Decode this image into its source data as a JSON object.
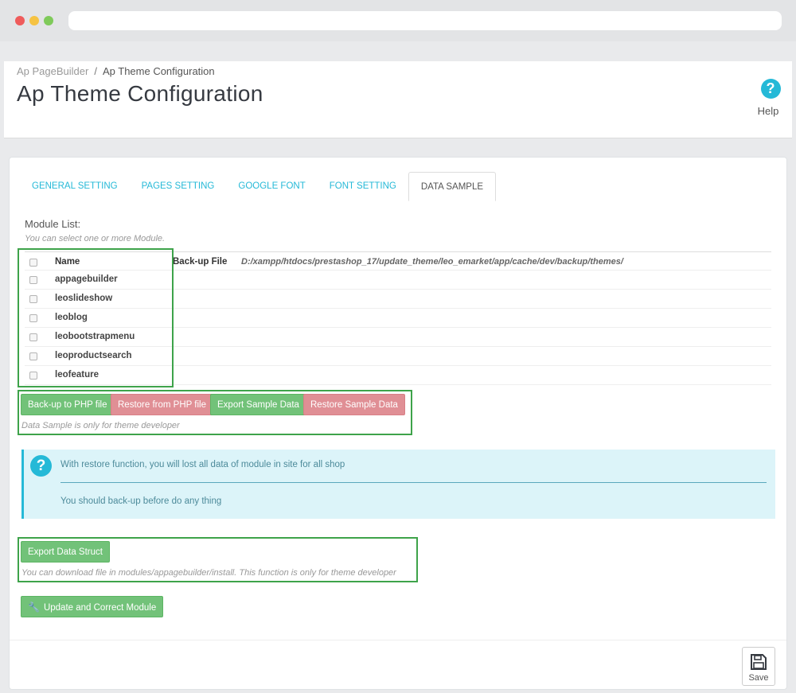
{
  "header": {
    "breadcrumb": [
      "Ap PageBuilder",
      "Ap Theme Configuration"
    ],
    "breadcrumb_sep": "/",
    "title": "Ap Theme Configuration",
    "help_icon_glyph": "?",
    "help_label": "Help"
  },
  "tabs": [
    {
      "label": "GENERAL SETTING",
      "active": false
    },
    {
      "label": "PAGES SETTING",
      "active": false
    },
    {
      "label": "GOOGLE FONT",
      "active": false
    },
    {
      "label": "FONT SETTING",
      "active": false
    },
    {
      "label": "DATA SAMPLE",
      "active": true
    }
  ],
  "module_list": {
    "label": "Module List:",
    "help": "You can select one or more Module.",
    "name_header": "Name",
    "backup_label": "Back-up File",
    "backup_path": "D:/xampp/htdocs/prestashop_17/update_theme/leo_emarket/app/cache/dev/backup/themes/",
    "modules": [
      "appagebuilder",
      "leoslideshow",
      "leoblog",
      "leobootstrapmenu",
      "leoproductsearch",
      "leofeature"
    ]
  },
  "actions": {
    "backup_php": "Back-up to PHP file",
    "restore_php": "Restore from PHP file",
    "export_sample": "Export Sample Data",
    "restore_sample": "Restore Sample Data",
    "note": "Data Sample is only for theme developer"
  },
  "alert": {
    "icon_glyph": "?",
    "line1": "With restore function, you will lost all data of module in site for all shop",
    "line2": "You should back-up before do any thing"
  },
  "export_struct": {
    "button": "Export Data Struct",
    "note": "You can download file in modules/appagebuilder/install. This function is only for theme developer"
  },
  "update_button": "Update and Correct Module",
  "save_label": "Save",
  "colors": {
    "accent": "#25b9d7",
    "success": "#72c279",
    "danger": "#e08f95",
    "alert_bg": "#dcf4f9",
    "highlight": "#3ea34a"
  }
}
